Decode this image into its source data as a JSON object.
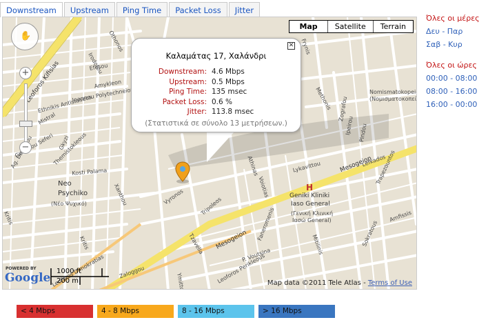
{
  "tabs": [
    "Downstream",
    "Upstream",
    "Ping Time",
    "Packet Loss",
    "Jitter"
  ],
  "map": {
    "types": [
      "Map",
      "Satellite",
      "Terrain"
    ],
    "streets": {
      "leoforos_kifisias": "Leoforos Kifisias",
      "mesogeion": "Mesogeion",
      "mesogeion2": "Mesogeion",
      "leoforos_perikleous": "Leoforos Perikleous",
      "leoforos_dimokratias": "Leoforos Dimokratias",
      "vyronos": "Vyronos",
      "tripoleos": "Tripoleos",
      "tzavella": "Tzavella",
      "faneromenis": "Faneromenis",
      "kritis": "Kritis",
      "kritis2": "Kritis",
      "xanthou": "Xanthou",
      "efesou": "Efesou",
      "amykleon": "Amykleon",
      "ioannou_polytechneiou": "Ioannou Polytechneiou",
      "mistral": "Mistral",
      "kosti_palama": "Kosti Palama",
      "georgiou_seferi": "Georgiou Seferi",
      "themistokleous": "Themistokleous",
      "gkyzi": "Gkyzi",
      "irodotou": "Irodotou",
      "athinas": "Athinas",
      "methonis": "Methonis",
      "zografou": "Zografou",
      "ipeirou": "Ipeirou",
      "pindou": "Pindou",
      "voiotias": "Voiotias",
      "lykavittou": "Lykavittou",
      "iatrou": "P. Voutsina",
      "nomismatokopeio": "Nomismatokopeio",
      "nomismatokopeio_gr": "(Νομισματοκοπείο)",
      "mitilinis": "Mitilinis",
      "sokratous": "Sokratous",
      "frynis": "Frynis",
      "ampelokipi": "Amfissis",
      "hospital_en": "Geniki Kliniki",
      "hospital_en2": "Iaso General",
      "hospital_gr": "(Γενική Κλινική",
      "hospital_gr2": "Ιασώ General)",
      "neo": "Neo",
      "psychiko": "Psychiko",
      "psychiko_gr": "(Νέο Ψυχικό)",
      "othonos": "Othonos",
      "eth_antistaseos": "Ethnikis Antistaseos",
      "ag_dimitriou": "Ag. Dimitriou",
      "zalongou": "Zaloggou",
      "ymittou": "Ymittou",
      "lefkados": "Lefkados",
      "trepezos": "Trapezountos"
    },
    "bubble": {
      "title": "Καλαμάτας 17, Χαλάνδρι",
      "stats": [
        {
          "label": "Downstream:",
          "value": "4.6 Mbps"
        },
        {
          "label": "Upstream:",
          "value": "0.5 Mbps"
        },
        {
          "label": "Ping Time:",
          "value": "135 msec"
        },
        {
          "label": "Packet Loss:",
          "value": "0.6 %"
        },
        {
          "label": "Jitter:",
          "value": "113.8 msec"
        }
      ],
      "note": "(Στατιστικά σε σύνολο 13 μετρήσεων.)"
    },
    "powered_by": "POWERED BY",
    "logo_text": "Google",
    "scale": {
      "ft": "1000 ft",
      "m": "200 m"
    },
    "attribution": "Map data ©2011 Tele Atlas - ",
    "terms": "Terms of Use",
    "hospital_marker": "H"
  },
  "side": {
    "days_header": "Όλες οι μέρες",
    "days": [
      "Δευ - Παρ",
      "Σαβ - Κυρ"
    ],
    "hours_header": "Όλες οι ώρες",
    "hours": [
      "00:00 - 08:00",
      "08:00 - 16:00",
      "16:00 - 00:00"
    ]
  },
  "legend": [
    {
      "label": "< 4 Mbps",
      "color": "#d83030"
    },
    {
      "label": "4 - 8 Mbps",
      "color": "#f8a81c"
    },
    {
      "label": "8 - 16 Mbps",
      "color": "#5cc4ec"
    },
    {
      "label": "> 16 Mbps",
      "color": "#3a76c0"
    }
  ],
  "colors": {
    "road_major": "#f5e36a",
    "road_minor": "#ffffff",
    "map_bg": "#e8e2d4"
  }
}
